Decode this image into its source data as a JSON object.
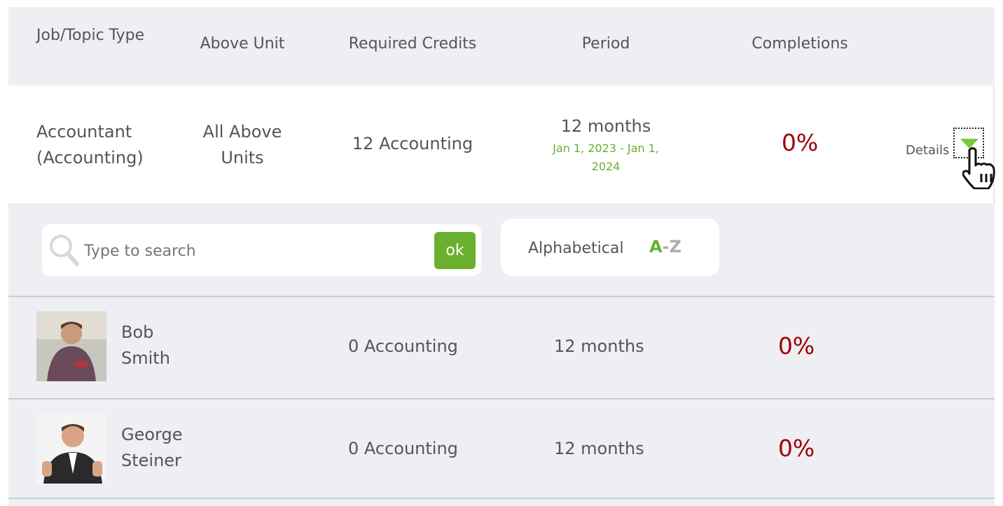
{
  "header": {
    "columns": [
      "Job/Topic Type",
      "Above Unit",
      "Required Credits",
      "Period",
      "Completions"
    ]
  },
  "main_row": {
    "job": "Accountant (Accounting)",
    "above_unit": "All Above Units",
    "required_credits": "12 Accounting",
    "period": "12 months",
    "period_range": "Jan 1, 2023 - Jan 1, 2024",
    "completions": "0%",
    "details_label": "Details",
    "details_icon": "triangle-down-icon"
  },
  "search": {
    "placeholder": "Type to search",
    "ok_label": "ok",
    "icon": "search-icon"
  },
  "sort": {
    "label": "Alphabetical",
    "icon_a": "A",
    "icon_sep": "-",
    "icon_z": "Z"
  },
  "users": [
    {
      "first": "Bob",
      "last": "Smith",
      "credits": "0 Accounting",
      "period": "12 months",
      "completions": "0%"
    },
    {
      "first": "George",
      "last": "Steiner",
      "credits": "0 Accounting",
      "period": "12 months",
      "completions": "0%"
    }
  ],
  "colors": {
    "accent": "#6ab02e",
    "percent": "#a00000",
    "background": "#eeeff3"
  }
}
